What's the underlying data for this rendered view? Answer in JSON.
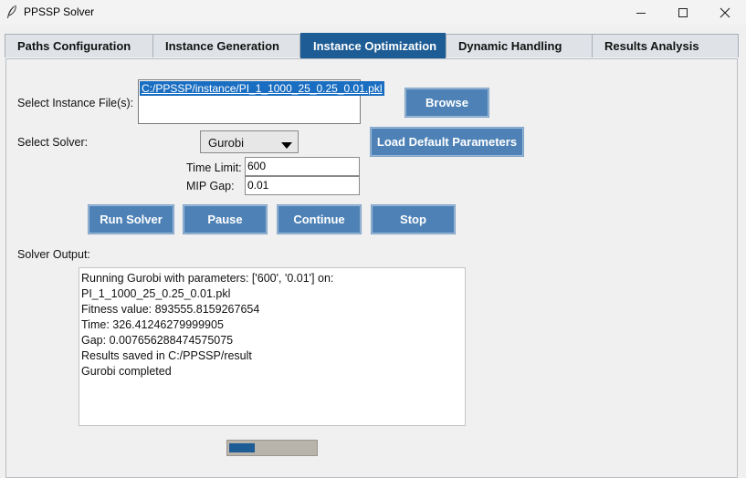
{
  "window": {
    "title": "PPSSP Solver",
    "icon": "feather-icon",
    "controls": [
      "minimize-icon",
      "maximize-icon",
      "close-icon"
    ]
  },
  "tabs": [
    {
      "label": "Paths Configuration",
      "active": false
    },
    {
      "label": "Instance Generation",
      "active": false
    },
    {
      "label": "Instance Optimization",
      "active": true
    },
    {
      "label": "Dynamic Handling",
      "active": false
    },
    {
      "label": "Results Analysis",
      "active": false
    }
  ],
  "form": {
    "instance_label": "Select Instance File(s):",
    "instance_files": [
      "C:/PPSSP/instance/PI_1_1000_25_0.25_0.01.pkl"
    ],
    "browse_label": "Browse",
    "solver_label": "Select Solver:",
    "solver_value": "Gurobi",
    "load_defaults_label": "Load Default Parameters",
    "time_limit_label": "Time Limit:",
    "time_limit_value": "600",
    "mip_gap_label": "MIP Gap:",
    "mip_gap_value": "0.01"
  },
  "actions": {
    "run_label": "Run Solver",
    "pause_label": "Pause",
    "continue_label": "Continue",
    "stop_label": "Stop"
  },
  "output": {
    "label": "Solver Output:",
    "lines": [
      "Running Gurobi with parameters: ['600', '0.01'] on:",
      "PI_1_1000_25_0.25_0.01.pkl",
      "Fitness value: 893555.8159267654",
      "Time: 326.41246279999905",
      "Gap: 0.007656288474575075",
      "Results saved in C:/PPSSP/result",
      "Gurobi completed"
    ]
  },
  "progress": {
    "fraction": 0.3
  },
  "colors": {
    "accent": "#1e5c95",
    "button": "#4e82b6",
    "selection": "#1a6ec2"
  }
}
